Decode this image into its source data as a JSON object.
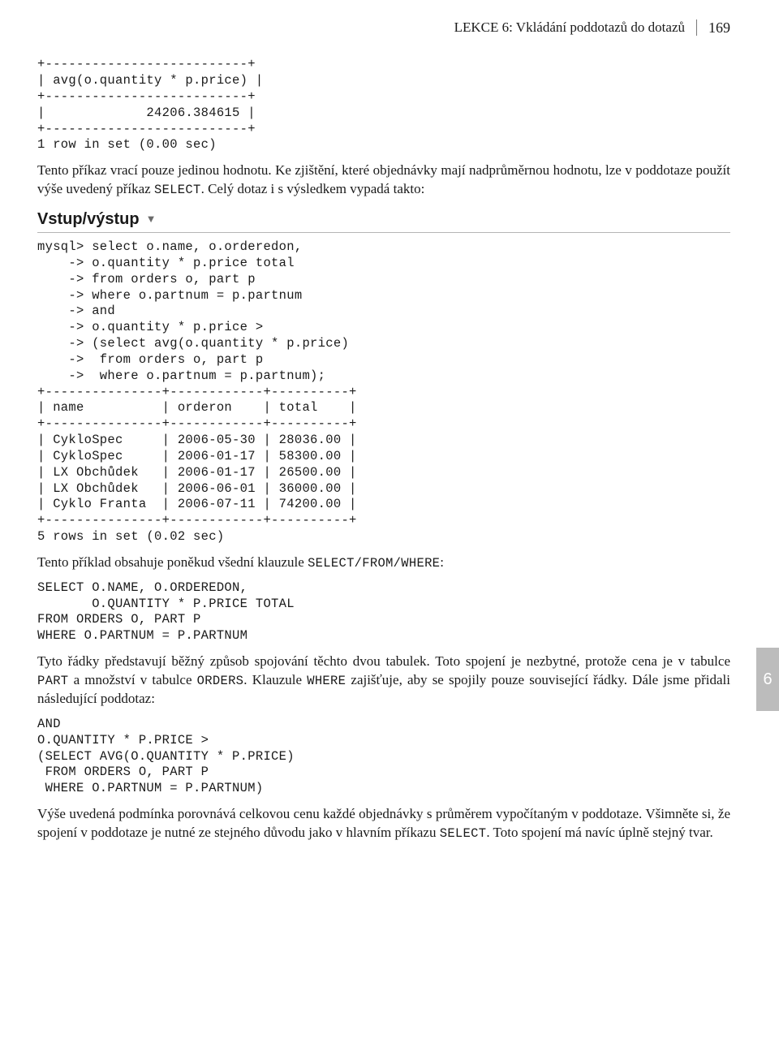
{
  "runningHead": {
    "title": "LEKCE 6: Vkládání poddotazů do dotazů",
    "pageNumber": "169"
  },
  "sideTab": "6",
  "blocks": {
    "code1": "+--------------------------+\n| avg(o.quantity * p.price) |\n+--------------------------+\n|             24206.384615 |\n+--------------------------+\n1 row in set (0.00 sec)",
    "para1_a": "Tento příkaz vrací pouze jedinou hodnotu. Ke zjištění, které objednávky mají nadprůměrnou hodnotu, lze v poddotaze použít výše uvedený příkaz ",
    "para1_code": "SELECT",
    "para1_b": ". Celý dotaz i s výsledkem vypadá takto:",
    "heading1": "Vstup/výstup",
    "code2": "mysql> select o.name, o.orderedon,\n    -> o.quantity * p.price total\n    -> from orders o, part p\n    -> where o.partnum = p.partnum\n    -> and\n    -> o.quantity * p.price >\n    -> (select avg(o.quantity * p.price)\n    ->  from orders o, part p\n    ->  where o.partnum = p.partnum);\n+---------------+------------+----------+\n| name          | orderon    | total    |\n+---------------+------------+----------+\n| CykloSpec     | 2006-05-30 | 28036.00 |\n| CykloSpec     | 2006-01-17 | 58300.00 |\n| LX Obchůdek   | 2006-01-17 | 26500.00 |\n| LX Obchůdek   | 2006-06-01 | 36000.00 |\n| Cyklo Franta  | 2006-07-11 | 74200.00 |\n+---------------+------------+----------+\n5 rows in set (0.02 sec)",
    "para2_a": "Tento příklad obsahuje poněkud všední klauzule ",
    "para2_code": "SELECT/FROM/WHERE",
    "para2_b": ":",
    "code3": "SELECT O.NAME, O.ORDEREDON,\n       O.QUANTITY * P.PRICE TOTAL\nFROM ORDERS O, PART P\nWHERE O.PARTNUM = P.PARTNUM",
    "para3_a": "Tyto řádky představují běžný způsob spojování těchto dvou tabulek. Toto spojení je nezbytné, protože cena je v tabulce ",
    "para3_code1": "PART",
    "para3_b": " a množství v tabulce ",
    "para3_code2": "ORDERS",
    "para3_c": ". Klauzule ",
    "para3_code3": "WHERE",
    "para3_d": " zajišťuje, aby se spojily pouze související řádky. Dále jsme přidali následující poddotaz:",
    "code4": "AND\nO.QUANTITY * P.PRICE >\n(SELECT AVG(O.QUANTITY * P.PRICE)\n FROM ORDERS O, PART P\n WHERE O.PARTNUM = P.PARTNUM)",
    "para4_a": "Výše uvedená podmínka porovnává celkovou cenu každé objednávky s průměrem vypočítaným v poddotaze. Všimněte si, že spojení v poddotaze je nutné ze stejného důvodu jako v hlavním příkazu ",
    "para4_code": "SELECT",
    "para4_b": ". Toto spojení má navíc úplně stejný tvar."
  },
  "chart_data": {
    "type": "table",
    "columns": [
      "name",
      "orderon",
      "total"
    ],
    "rows": [
      {
        "name": "CykloSpec",
        "orderon": "2006-05-30",
        "total": 28036.0
      },
      {
        "name": "CykloSpec",
        "orderon": "2006-01-17",
        "total": 58300.0
      },
      {
        "name": "LX Obchůdek",
        "orderon": "2006-01-17",
        "total": 26500.0
      },
      {
        "name": "LX Obchůdek",
        "orderon": "2006-06-01",
        "total": 36000.0
      },
      {
        "name": "Cyklo Franta",
        "orderon": "2006-07-11",
        "total": 74200.0
      }
    ],
    "row_count": 5,
    "elapsed_sec": 0.02,
    "avg_quantity_times_price": 24206.384615
  }
}
